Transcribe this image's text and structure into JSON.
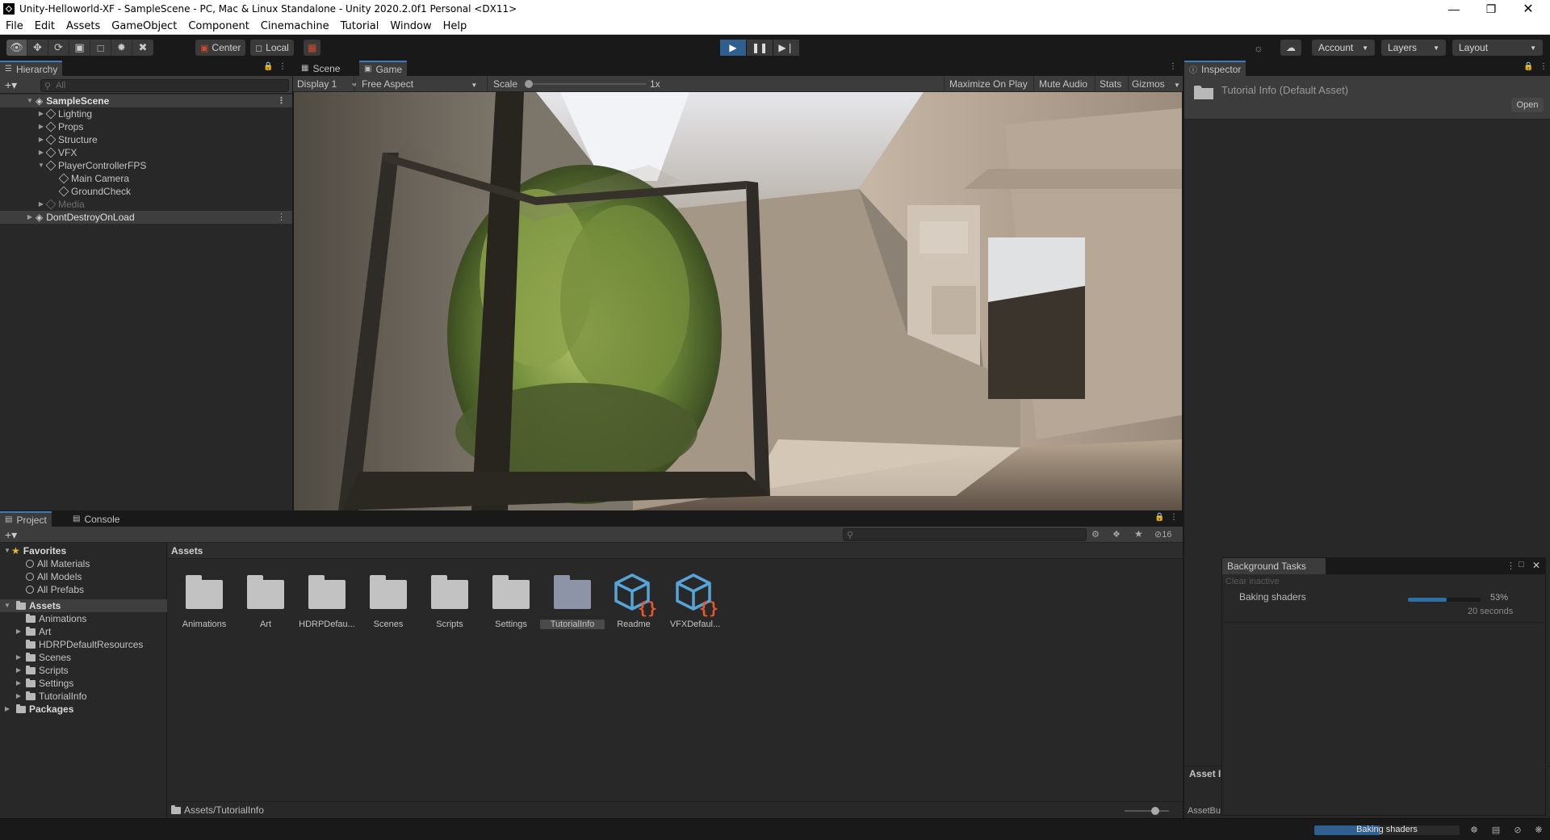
{
  "window": {
    "title": "Unity-Helloworld-XF - SampleScene - PC, Mac & Linux Standalone - Unity 2020.2.0f1 Personal <DX11>"
  },
  "menu": [
    "File",
    "Edit",
    "Assets",
    "GameObject",
    "Component",
    "Cinemachine",
    "Tutorial",
    "Window",
    "Help"
  ],
  "toolbar": {
    "pivot": "Center",
    "space": "Local",
    "account": "Account",
    "layers": "Layers",
    "layout": "Layout"
  },
  "hierarchy": {
    "tab": "Hierarchy",
    "search_placeholder": "All",
    "scene": "SampleScene",
    "items": [
      "Lighting",
      "Props",
      "Structure",
      "VFX",
      "PlayerControllerFPS",
      "Main Camera",
      "GroundCheck",
      "Media"
    ],
    "dont_destroy": "DontDestroyOnLoad"
  },
  "game": {
    "tab_scene": "Scene",
    "tab_game": "Game",
    "display": "Display 1",
    "aspect": "Free Aspect",
    "scale_label": "Scale",
    "scale_value": "1x",
    "maximize": "Maximize On Play",
    "mute": "Mute Audio",
    "stats": "Stats",
    "gizmos": "Gizmos"
  },
  "inspector": {
    "tab": "Inspector",
    "title": "Tutorial Info (Default Asset)",
    "open_button": "Open",
    "asset_label": "Asset I",
    "asset_bundle": "AssetBu"
  },
  "project": {
    "tab_project": "Project",
    "tab_console": "Console",
    "hidden_count": "16",
    "favorites_label": "Favorites",
    "favorites": [
      "All Materials",
      "All Models",
      "All Prefabs"
    ],
    "assets_label": "Assets",
    "asset_folders": [
      "Animations",
      "Art",
      "HDRPDefaultResources",
      "Scenes",
      "Scripts",
      "Settings",
      "TutorialInfo"
    ],
    "packages_label": "Packages",
    "grid_header": "Assets",
    "grid_items": [
      "Animations",
      "Art",
      "HDRPDefau...",
      "Scenes",
      "Scripts",
      "Settings",
      "TutorialInfo",
      "Readme",
      "VFXDefaul..."
    ],
    "path": "Assets/TutorialInfo"
  },
  "background_tasks": {
    "title": "Background Tasks",
    "clear_inactive": "Clear inactive",
    "task_name": "Baking shaders",
    "percent": "53%",
    "progress": 0.53,
    "eta": "20 seconds"
  },
  "status": {
    "task": "Baking shaders",
    "progress": 0.45
  },
  "colors": {
    "accent": "#3a79bb",
    "play_active": "#2f5f8f",
    "script_orange": "#e5572c",
    "script_blue": "#56a5d8"
  }
}
